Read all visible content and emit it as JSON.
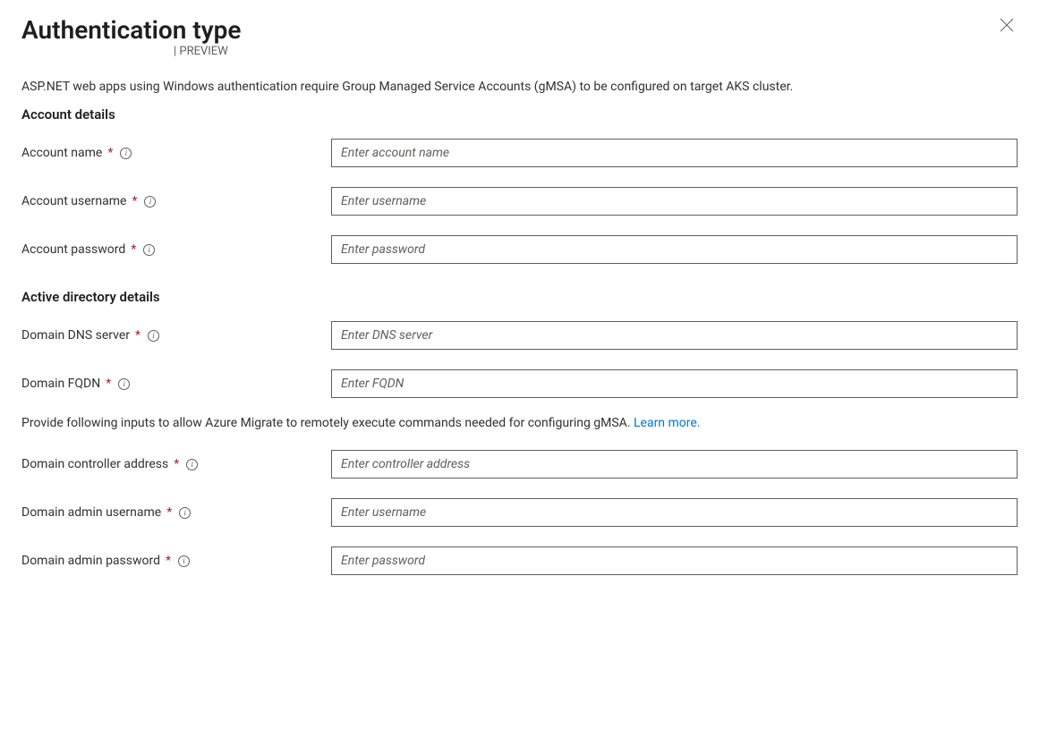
{
  "header": {
    "title": "Authentication type",
    "preview_badge": "| PREVIEW"
  },
  "intro": "ASP.NET web apps using Windows authentication require Group Managed Service Accounts (gMSA) to be configured on target AKS cluster.",
  "account_section": {
    "title": "Account details",
    "fields": {
      "account_name": {
        "label": "Account name",
        "placeholder": "Enter account name"
      },
      "account_username": {
        "label": "Account username",
        "placeholder": "Enter username"
      },
      "account_password": {
        "label": "Account password",
        "placeholder": "Enter password"
      }
    }
  },
  "ad_section": {
    "title": "Active directory details",
    "fields": {
      "dns_server": {
        "label": "Domain DNS server",
        "placeholder": "Enter DNS server"
      },
      "fqdn": {
        "label": "Domain FQDN",
        "placeholder": "Enter FQDN"
      },
      "controller": {
        "label": "Domain controller address",
        "placeholder": "Enter controller address"
      },
      "admin_username": {
        "label": "Domain admin username",
        "placeholder": "Enter username"
      },
      "admin_password": {
        "label": "Domain admin password",
        "placeholder": "Enter password"
      }
    },
    "helper_text": "Provide following inputs to allow Azure Migrate to remotely execute commands needed for configuring gMSA. ",
    "learn_more": "Learn more."
  }
}
